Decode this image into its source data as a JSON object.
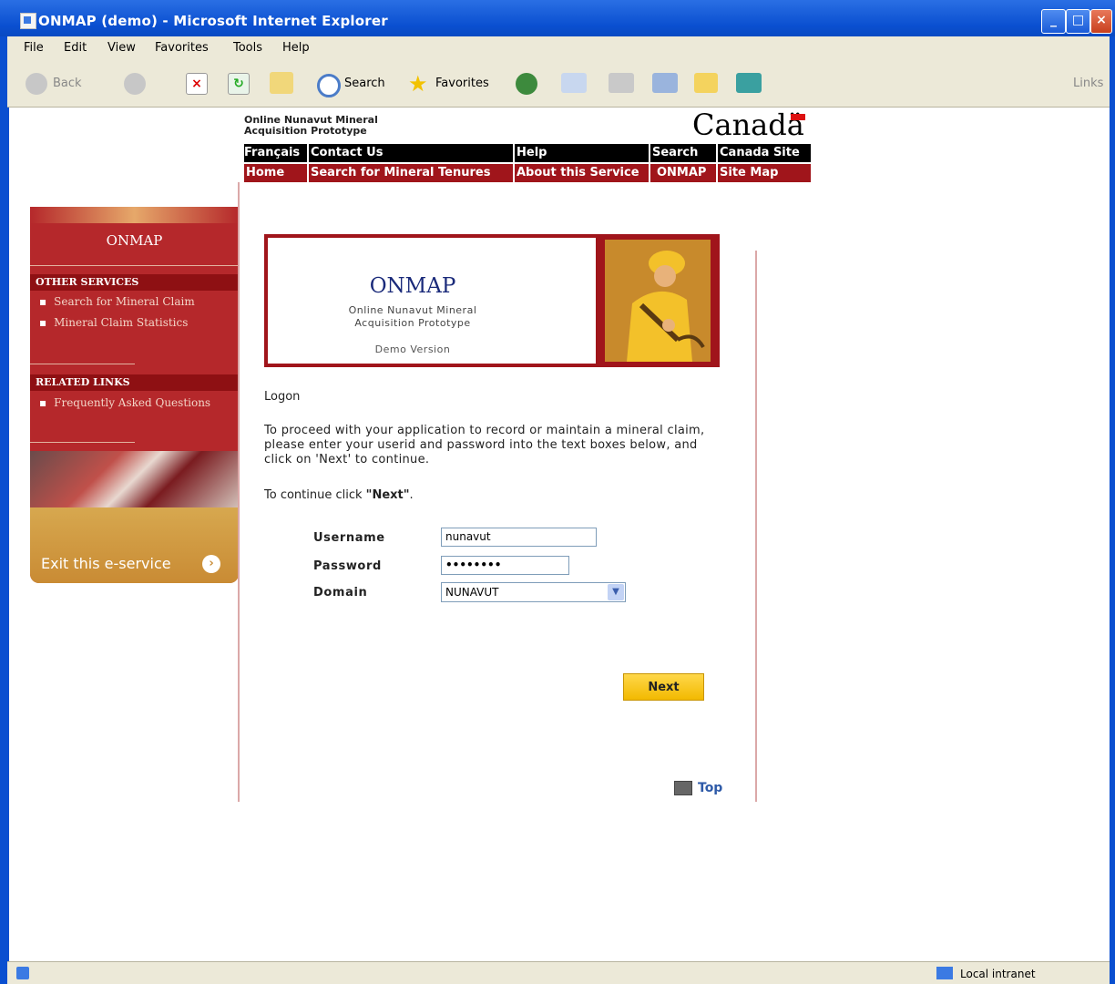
{
  "window": {
    "title": "ONMAP (demo) - Microsoft Internet Explorer"
  },
  "menu": [
    "File",
    "Edit",
    "View",
    "Favorites",
    "Tools",
    "Help"
  ],
  "toolbar": {
    "back": "Back",
    "search": "Search",
    "favorites": "Favorites",
    "links": "Links"
  },
  "status": {
    "zone": "Local intranet"
  },
  "site": {
    "header_line1": "Online Nunavut Mineral",
    "header_line2": "Acquisition Prototype",
    "wordmark": "Canadä",
    "nav_row1": [
      "Français",
      "Contact Us",
      "Help",
      "Search",
      "Canada Site"
    ],
    "nav_row2": [
      "Home",
      "Search for Mineral Tenures",
      "About this Service",
      "ONMAP",
      "Site Map"
    ]
  },
  "sidebar": {
    "title": "ONMAP",
    "other_services_heading": "OTHER SERVICES",
    "other_services": [
      "Search for Mineral Claim",
      "Mineral Claim Statistics"
    ],
    "related_links_heading": "RELATED LINKS",
    "related_links": [
      "Frequently Asked Questions"
    ],
    "exit": "Exit this e-service"
  },
  "banner": {
    "title": "ONMAP",
    "sub1": "Online Nunavut Mineral",
    "sub2": "Acquisition Prototype",
    "demo": "Demo Version"
  },
  "form": {
    "heading": "Logon",
    "intro": "To proceed with your application to record or maintain a mineral claim, please enter your userid and password into the text boxes below, and click on 'Next' to continue.",
    "continue_prefix": "To continue click",
    "continue_strong": "\"Next\"",
    "continue_suffix": ".",
    "username_label": "Username",
    "username_value": "nunavut",
    "password_label": "Password",
    "password_value": "••••••••",
    "domain_label": "Domain",
    "domain_value": "NUNAVUT",
    "next": "Next",
    "top": "Top"
  }
}
